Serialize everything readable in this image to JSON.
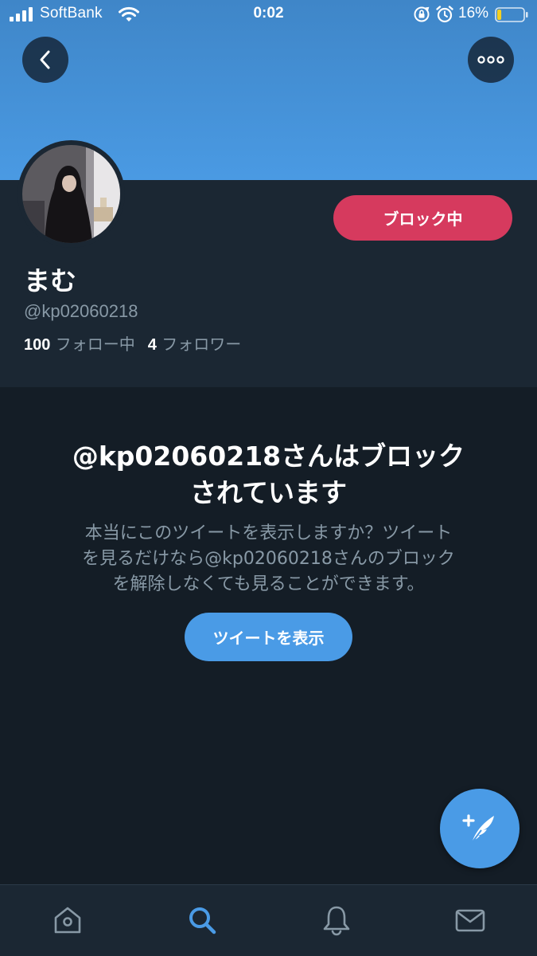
{
  "status_bar": {
    "carrier": "SoftBank",
    "time": "0:02",
    "battery_percent": "16%",
    "battery_level": 0.16
  },
  "profile": {
    "display_name": "まむ",
    "handle": "@kp02060218",
    "following_count": "100",
    "following_label": "フォロー中",
    "followers_count": "4",
    "followers_label": "フォロワー",
    "block_button_label": "ブロック中"
  },
  "blocked_notice": {
    "title_line1": "@kp02060218さんはブロック",
    "title_line2": "されています",
    "body_line1": "本当にこのツイートを表示しますか？ツイート",
    "body_line2": "を見るだけなら@kp02060218さんのブロック",
    "body_line3": "を解除しなくても見ることができます。",
    "show_tweets_label": "ツイートを表示"
  },
  "tab_bar": {
    "tabs": [
      {
        "icon": "home-icon",
        "active": false
      },
      {
        "icon": "search-icon",
        "active": true
      },
      {
        "icon": "bell-icon",
        "active": false
      },
      {
        "icon": "mail-icon",
        "active": false
      }
    ]
  },
  "colors": {
    "background": "#141d26",
    "profile_background": "#1b2733",
    "banner": "#4a9ae3",
    "accent_blue": "#4a9be6",
    "block_red": "#d63a5e",
    "secondary_text": "#8899a6"
  }
}
